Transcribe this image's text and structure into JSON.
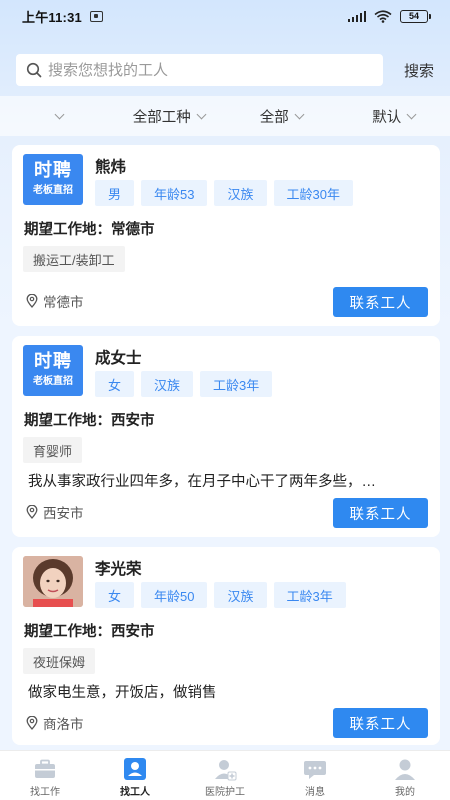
{
  "status_bar": {
    "time": "上午11:31",
    "battery": "54"
  },
  "search": {
    "placeholder": "搜索您想找的工人",
    "value": "",
    "button_label": "搜索"
  },
  "filters": [
    {
      "label": ""
    },
    {
      "label": "全部工种"
    },
    {
      "label": "全部"
    },
    {
      "label": "默认"
    }
  ],
  "workers": [
    {
      "badge_line1": "时聘",
      "badge_line2": "老板直招",
      "name": "熊炜",
      "tags": [
        "男",
        "年龄53",
        "汉族",
        "工龄30年"
      ],
      "expect_location": "期望工作地：常德市",
      "job": "搬运工/装卸工",
      "description": "",
      "location": "常德市",
      "contact_label": "联系工人"
    },
    {
      "badge_line1": "时聘",
      "badge_line2": "老板直招",
      "name": "成女士",
      "tags": [
        "女",
        "汉族",
        "工龄3年"
      ],
      "expect_location": "期望工作地：西安市",
      "job": "育婴师",
      "description": "我从事家政行业四年多，在月子中心干了两年多些，…",
      "location": "西安市",
      "contact_label": "联系工人"
    },
    {
      "name": "李光荣",
      "tags": [
        "女",
        "年龄50",
        "汉族",
        "工龄3年"
      ],
      "expect_location": "期望工作地：西安市",
      "job": "夜班保姆",
      "description": "做家电生意，开饭店，做销售",
      "location": "商洛市",
      "contact_label": "联系工人"
    }
  ],
  "tab_bar": [
    {
      "label": "找工作",
      "icon": "briefcase-icon",
      "active": false
    },
    {
      "label": "找工人",
      "icon": "worker-icon",
      "active": true
    },
    {
      "label": "医院护工",
      "icon": "nurse-icon",
      "active": false
    },
    {
      "label": "消息",
      "icon": "message-icon",
      "active": false
    },
    {
      "label": "我的",
      "icon": "profile-icon",
      "active": false
    }
  ],
  "colors": {
    "accent": "#2f89f0",
    "tag_bg": "#eaf3fe",
    "badge_bg": "#3a88f0"
  }
}
